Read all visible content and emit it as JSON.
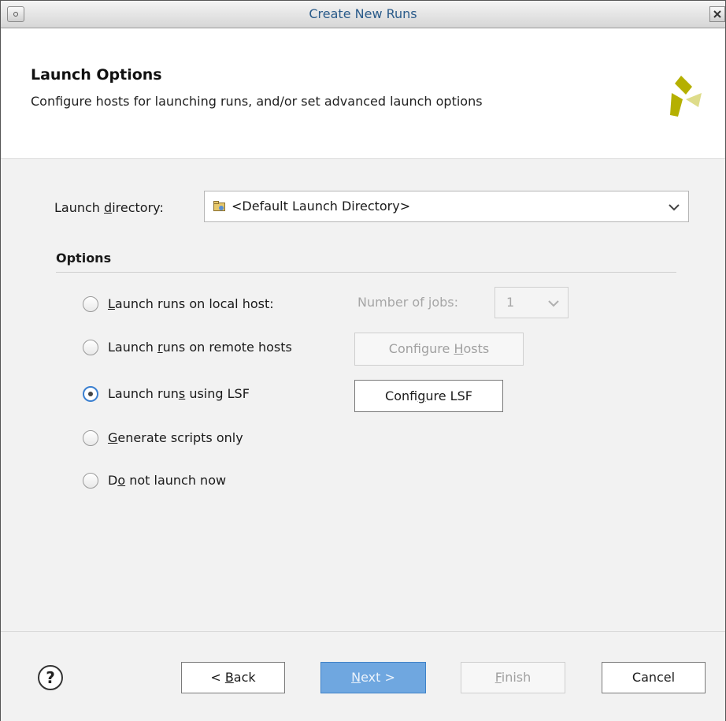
{
  "window": {
    "title": "Create New Runs"
  },
  "header": {
    "title": "Launch Options",
    "subtitle": "Configure hosts for launching runs, and/or set advanced launch options"
  },
  "launch_directory": {
    "label_pre": "Launch ",
    "label_key": "d",
    "label_post": "irectory:",
    "value": "<Default Launch Directory>"
  },
  "options": {
    "section_title": "Options",
    "local": {
      "pre": "",
      "key": "L",
      "post": "aunch runs on local host:",
      "selected": false
    },
    "jobs": {
      "pre": "Number of ",
      "key": "j",
      "post": "obs:",
      "value": "1"
    },
    "remote": {
      "pre": "Launch ",
      "key": "r",
      "post": "uns on remote hosts",
      "selected": false
    },
    "configure_hosts": {
      "pre": "Configure ",
      "key": "H",
      "post": "osts"
    },
    "lsf": {
      "pre": "Launch run",
      "key": "s",
      "post": " using LSF",
      "selected": true
    },
    "configure_lsf": {
      "pre": "Confi",
      "key": "g",
      "post": "ure LSF"
    },
    "scripts": {
      "pre": "",
      "key": "G",
      "post": "enerate scripts only",
      "selected": false
    },
    "not_now": {
      "pre": "D",
      "key": "o",
      "post": " not launch now",
      "selected": false
    }
  },
  "footer": {
    "help": "?",
    "back": {
      "pre": "< ",
      "key": "B",
      "post": "ack"
    },
    "next": {
      "pre": "",
      "key": "N",
      "post": "ext >"
    },
    "finish": {
      "pre": "",
      "key": "F",
      "post": "inish"
    },
    "cancel": "Cancel"
  },
  "colors": {
    "accent": "#4a8fd6",
    "title_text": "#2a5b8a",
    "logo_dark": "#b5b000",
    "logo_light": "#dedc8a"
  }
}
